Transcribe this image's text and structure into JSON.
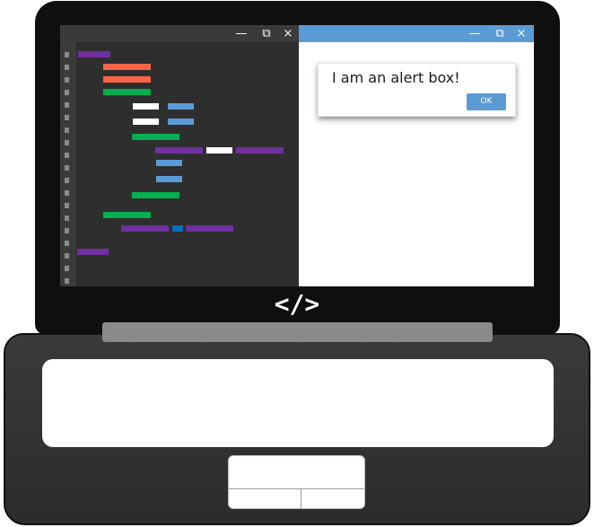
{
  "colors": {
    "purple": "#7030a0",
    "orange": "#ff6347",
    "green": "#00b050",
    "white": "#ffffff",
    "blue": "#5b9bd5",
    "dark_blue": "#0070c0",
    "titlebar_blue": "#5b9bd5"
  },
  "editor": {
    "window_controls": {
      "minimize": "—",
      "restore": "⧉",
      "close": "×"
    }
  },
  "browser": {
    "window_controls": {
      "minimize": "—",
      "restore": "⧉",
      "close": "×"
    },
    "alert": {
      "message": "I am an alert box!",
      "ok_label": "OK"
    }
  },
  "screen_symbol": "</>"
}
